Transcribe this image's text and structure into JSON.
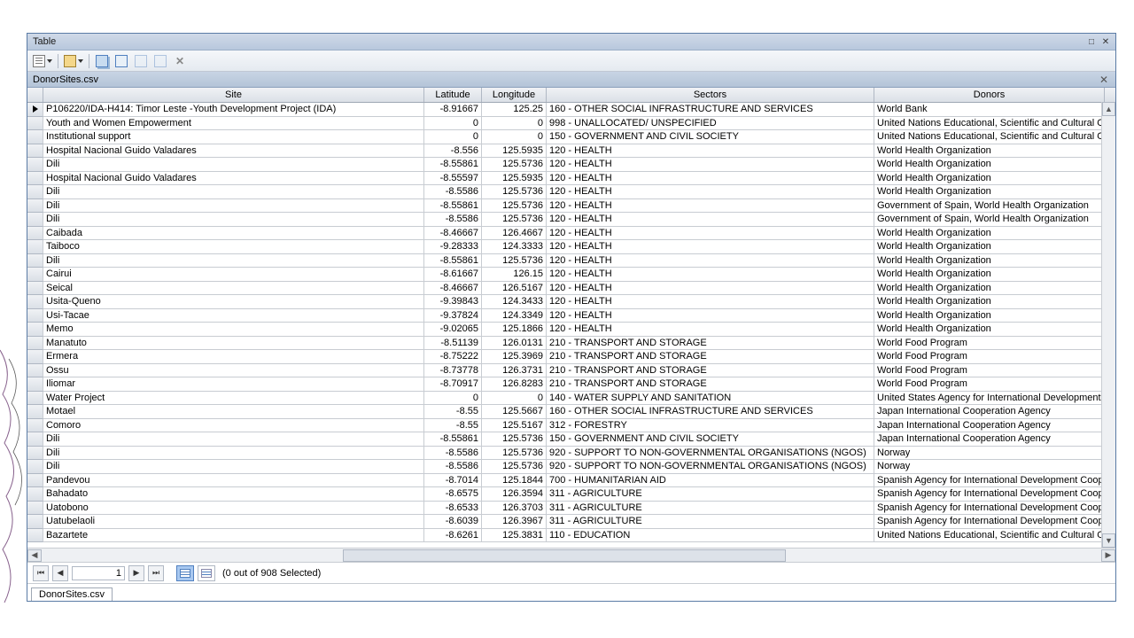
{
  "window": {
    "title": "Table"
  },
  "tab": {
    "name": "DonorSites.csv"
  },
  "columns": [
    "Site",
    "Latitude",
    "Longitude",
    "Sectors",
    "Donors"
  ],
  "nav": {
    "page": "1",
    "selected_text": "(0 out of 908 Selected)"
  },
  "sheet_tab": "DonorSites.csv",
  "rows": [
    {
      "marker": true,
      "site": "P106220/IDA-H414: Timor Leste -Youth Development Project (IDA)",
      "lat": "-8.91667",
      "lon": "125.25",
      "sectors": "160 - OTHER SOCIAL INFRASTRUCTURE AND SERVICES",
      "donors": "World Bank"
    },
    {
      "site": "Youth and Women Empowerment",
      "lat": "0",
      "lon": "0",
      "sectors": "998 - UNALLOCATED/ UNSPECIFIED",
      "donors": "United Nations Educational, Scientific and Cultural Org"
    },
    {
      "site": "Institutional support",
      "lat": "0",
      "lon": "0",
      "sectors": "150 - GOVERNMENT AND CIVIL SOCIETY",
      "donors": "United Nations Educational, Scientific and Cultural Org"
    },
    {
      "site": "Hospital Nacional Guido Valadares",
      "lat": "-8.556",
      "lon": "125.5935",
      "sectors": "120 - HEALTH",
      "donors": "World Health Organization"
    },
    {
      "site": "Dili",
      "lat": "-8.55861",
      "lon": "125.5736",
      "sectors": "120 - HEALTH",
      "donors": "World Health Organization"
    },
    {
      "site": "Hospital Nacional Guido Valadares",
      "lat": "-8.55597",
      "lon": "125.5935",
      "sectors": "120 - HEALTH",
      "donors": "World Health Organization"
    },
    {
      "site": "Dili",
      "lat": "-8.5586",
      "lon": "125.5736",
      "sectors": "120 - HEALTH",
      "donors": "World Health Organization"
    },
    {
      "site": "Dili",
      "lat": "-8.55861",
      "lon": "125.5736",
      "sectors": "120 - HEALTH",
      "donors": "Government of Spain, World Health Organization"
    },
    {
      "site": "Dili",
      "lat": "-8.5586",
      "lon": "125.5736",
      "sectors": "120 - HEALTH",
      "donors": "Government of Spain, World Health Organization"
    },
    {
      "site": "Caibada",
      "lat": "-8.46667",
      "lon": "126.4667",
      "sectors": "120 - HEALTH",
      "donors": "World Health Organization"
    },
    {
      "site": "Taiboco",
      "lat": "-9.28333",
      "lon": "124.3333",
      "sectors": "120 - HEALTH",
      "donors": "World Health Organization"
    },
    {
      "site": "Dili",
      "lat": "-8.55861",
      "lon": "125.5736",
      "sectors": "120 - HEALTH",
      "donors": "World Health Organization"
    },
    {
      "site": "Cairui",
      "lat": "-8.61667",
      "lon": "126.15",
      "sectors": "120 - HEALTH",
      "donors": "World Health Organization"
    },
    {
      "site": "Seical",
      "lat": "-8.46667",
      "lon": "126.5167",
      "sectors": "120 - HEALTH",
      "donors": "World Health Organization"
    },
    {
      "site": "Usita-Queno",
      "lat": "-9.39843",
      "lon": "124.3433",
      "sectors": "120 - HEALTH",
      "donors": "World Health Organization"
    },
    {
      "site": "Usi-Tacae",
      "lat": "-9.37824",
      "lon": "124.3349",
      "sectors": "120 - HEALTH",
      "donors": "World Health Organization"
    },
    {
      "site": "Memo",
      "lat": "-9.02065",
      "lon": "125.1866",
      "sectors": "120 - HEALTH",
      "donors": "World Health Organization"
    },
    {
      "site": "Manatuto",
      "lat": "-8.51139",
      "lon": "126.0131",
      "sectors": "210 - TRANSPORT AND STORAGE",
      "donors": "World Food Program"
    },
    {
      "site": "Ermera",
      "lat": "-8.75222",
      "lon": "125.3969",
      "sectors": "210 - TRANSPORT AND STORAGE",
      "donors": "World Food Program"
    },
    {
      "site": "Ossu",
      "lat": "-8.73778",
      "lon": "126.3731",
      "sectors": "210 - TRANSPORT AND STORAGE",
      "donors": "World Food Program"
    },
    {
      "site": "Iliomar",
      "lat": "-8.70917",
      "lon": "126.8283",
      "sectors": "210 - TRANSPORT AND STORAGE",
      "donors": "World Food Program"
    },
    {
      "site": "Water Project",
      "lat": "0",
      "lon": "0",
      "sectors": "140 - WATER SUPPLY AND SANITATION",
      "donors": "United States Agency for International Development"
    },
    {
      "site": "Motael",
      "lat": "-8.55",
      "lon": "125.5667",
      "sectors": "160 - OTHER SOCIAL INFRASTRUCTURE AND SERVICES",
      "donors": "Japan International Cooperation Agency"
    },
    {
      "site": "Comoro",
      "lat": "-8.55",
      "lon": "125.5167",
      "sectors": "312 - FORESTRY",
      "donors": "Japan International Cooperation Agency"
    },
    {
      "site": "Dili",
      "lat": "-8.55861",
      "lon": "125.5736",
      "sectors": "150 - GOVERNMENT AND CIVIL SOCIETY",
      "donors": "Japan International Cooperation Agency"
    },
    {
      "site": "Dili",
      "lat": "-8.5586",
      "lon": "125.5736",
      "sectors": "920 - SUPPORT TO NON-GOVERNMENTAL ORGANISATIONS (NGOS)",
      "donors": "Norway"
    },
    {
      "site": "Dili",
      "lat": "-8.5586",
      "lon": "125.5736",
      "sectors": "920 - SUPPORT TO NON-GOVERNMENTAL ORGANISATIONS (NGOS)",
      "donors": "Norway"
    },
    {
      "site": "Pandevou",
      "lat": "-8.7014",
      "lon": "125.1844",
      "sectors": "700 - HUMANITARIAN AID",
      "donors": "Spanish Agency for International Development Coope"
    },
    {
      "site": "Bahadato",
      "lat": "-8.6575",
      "lon": "126.3594",
      "sectors": "311 - AGRICULTURE",
      "donors": "Spanish Agency for International Development Coope"
    },
    {
      "site": "Uatobono",
      "lat": "-8.6533",
      "lon": "126.3703",
      "sectors": "311 - AGRICULTURE",
      "donors": "Spanish Agency for International Development Coope"
    },
    {
      "site": "Uatubelaoli",
      "lat": "-8.6039",
      "lon": "126.3967",
      "sectors": "311 - AGRICULTURE",
      "donors": "Spanish Agency for International Development Coope"
    },
    {
      "site": "Bazartete",
      "lat": "-8.6261",
      "lon": "125.3831",
      "sectors": "110 - EDUCATION",
      "donors": "United Nations Educational, Scientific and Cultural Org"
    }
  ]
}
